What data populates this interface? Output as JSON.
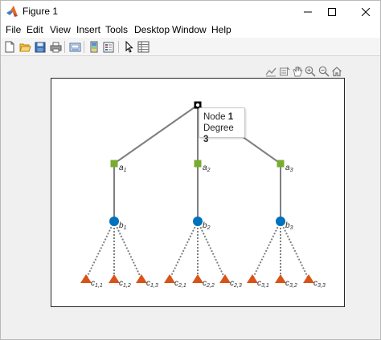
{
  "window": {
    "title": "Figure 1"
  },
  "menu": [
    {
      "id": "file",
      "label": "File"
    },
    {
      "id": "edit",
      "label": "Edit"
    },
    {
      "id": "view",
      "label": "View"
    },
    {
      "id": "insert",
      "label": "Insert"
    },
    {
      "id": "tools",
      "label": "Tools"
    },
    {
      "id": "desktop",
      "label": "Desktop"
    },
    {
      "id": "window",
      "label": "Window"
    },
    {
      "id": "help",
      "label": "Help"
    }
  ],
  "toolbar": {
    "buttons": [
      "new-figure-icon",
      "open-file-icon",
      "save-icon",
      "print-icon",
      "link-plot-icon",
      "insert-colorbar-icon",
      "insert-legend-icon",
      "edit-plot-icon",
      "property-inspector-icon"
    ]
  },
  "axes_toolbar": {
    "buttons": [
      "export-icon",
      "brush-icon",
      "pan-icon",
      "zoom-in-icon",
      "zoom-out-icon",
      "restore-view-icon"
    ]
  },
  "graph": {
    "edge_color": "#7f7f7f",
    "colors": {
      "root": "#000000",
      "a": "#77ac30",
      "b": "#0072bd",
      "c": "#d95319"
    },
    "nodes": [
      {
        "id": "root",
        "label": "",
        "sub": "",
        "marker": "square"
      },
      {
        "id": "a1",
        "label": "a",
        "sub": "1",
        "marker": "square"
      },
      {
        "id": "a2",
        "label": "a",
        "sub": "2",
        "marker": "square"
      },
      {
        "id": "a3",
        "label": "a",
        "sub": "3",
        "marker": "square"
      },
      {
        "id": "b1",
        "label": "b",
        "sub": "1",
        "marker": "circle"
      },
      {
        "id": "b2",
        "label": "b",
        "sub": "2",
        "marker": "circle"
      },
      {
        "id": "b3",
        "label": "b",
        "sub": "3",
        "marker": "circle"
      },
      {
        "id": "c11",
        "label": "c",
        "sub": "1,1",
        "marker": "triangle"
      },
      {
        "id": "c12",
        "label": "c",
        "sub": "1,2",
        "marker": "triangle"
      },
      {
        "id": "c13",
        "label": "c",
        "sub": "1,3",
        "marker": "triangle"
      },
      {
        "id": "c21",
        "label": "c",
        "sub": "2,1",
        "marker": "triangle"
      },
      {
        "id": "c22",
        "label": "c",
        "sub": "2,2",
        "marker": "triangle"
      },
      {
        "id": "c23",
        "label": "c",
        "sub": "2,3",
        "marker": "triangle"
      },
      {
        "id": "c31",
        "label": "c",
        "sub": "3,1",
        "marker": "triangle"
      },
      {
        "id": "c32",
        "label": "c",
        "sub": "3,2",
        "marker": "triangle"
      },
      {
        "id": "c33",
        "label": "c",
        "sub": "3,3",
        "marker": "triangle"
      }
    ],
    "edges": [
      {
        "from": "root",
        "to": "a1",
        "style": "solid"
      },
      {
        "from": "root",
        "to": "a2",
        "style": "solid"
      },
      {
        "from": "root",
        "to": "a3",
        "style": "solid"
      },
      {
        "from": "a1",
        "to": "b1",
        "style": "solid"
      },
      {
        "from": "a2",
        "to": "b2",
        "style": "solid"
      },
      {
        "from": "a3",
        "to": "b3",
        "style": "solid"
      },
      {
        "from": "b1",
        "to": "c11",
        "style": "dotted"
      },
      {
        "from": "b1",
        "to": "c12",
        "style": "dotted"
      },
      {
        "from": "b1",
        "to": "c13",
        "style": "dotted"
      },
      {
        "from": "b2",
        "to": "c21",
        "style": "dotted"
      },
      {
        "from": "b2",
        "to": "c22",
        "style": "dotted"
      },
      {
        "from": "b2",
        "to": "c23",
        "style": "dotted"
      },
      {
        "from": "b3",
        "to": "c31",
        "style": "dotted"
      },
      {
        "from": "b3",
        "to": "c32",
        "style": "dotted"
      },
      {
        "from": "b3",
        "to": "c33",
        "style": "dotted"
      }
    ]
  },
  "datatip": {
    "node_label": "Node",
    "node_value": "1",
    "degree_label": "Degree",
    "degree_value": "3"
  }
}
